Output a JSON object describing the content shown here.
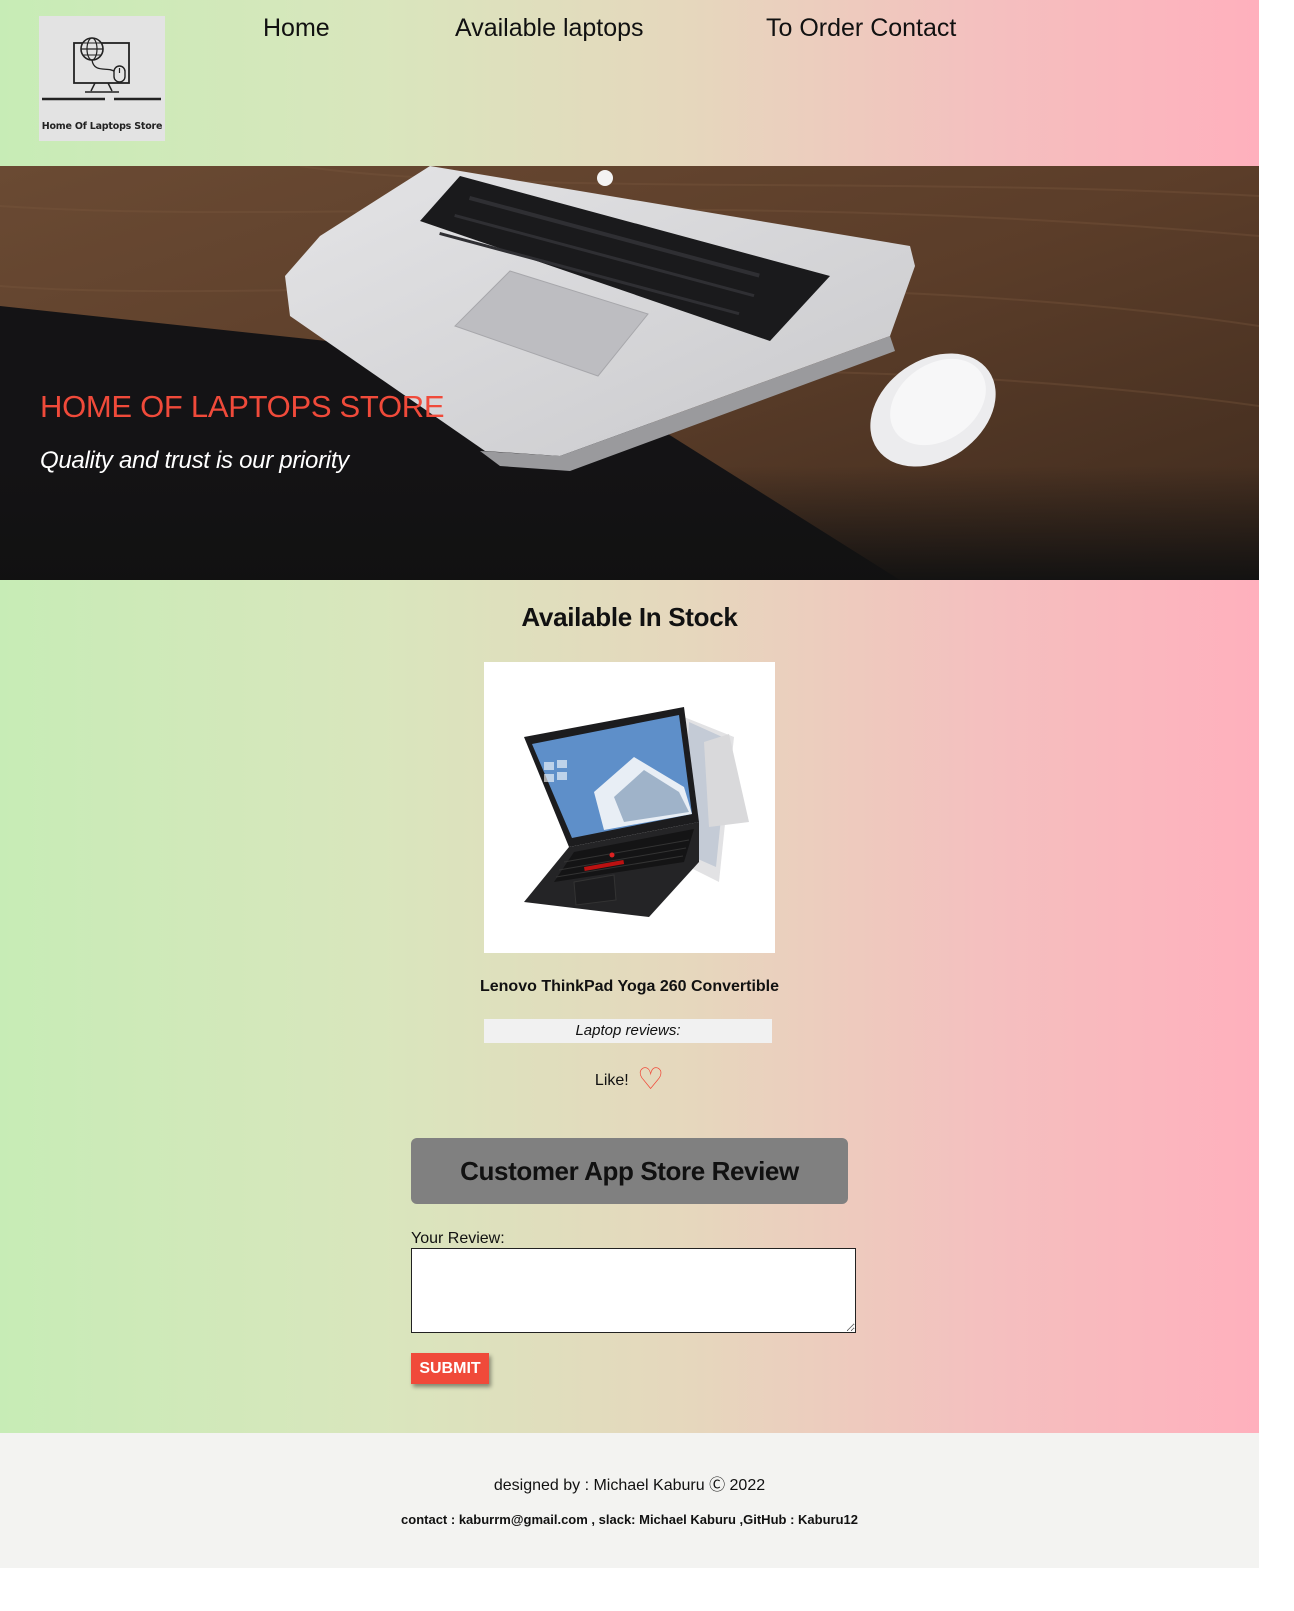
{
  "header": {
    "logo_text": "Home Of Laptops Store",
    "nav": [
      {
        "label": "Home"
      },
      {
        "label": "Available laptops"
      },
      {
        "label": "To Order Contact"
      }
    ]
  },
  "hero": {
    "title": "HOME OF LAPTOPS STORE",
    "subtitle": "Quality and trust is our priority"
  },
  "stock": {
    "title": "Available In Stock",
    "product_name": "Lenovo ThinkPad Yoga 260 Convertible",
    "reviews_label": "Laptop reviews:",
    "like_label": "Like!",
    "like_icon": "♡"
  },
  "review_form": {
    "banner": "Customer App Store Review",
    "label": "Your Review:",
    "value": "",
    "submit_label": "SUBMIT"
  },
  "footer": {
    "credit": "designed by : Michael Kaburu Ⓒ 2022",
    "contact": "contact : kaburrm@gmail.com , slack: Michael Kaburu ,GitHub : Kaburu12"
  },
  "colors": {
    "accent": "#f04a3a",
    "gradient_left": "#c7ecb6",
    "gradient_right": "#ffb0bd",
    "banner_gray": "#808080"
  }
}
